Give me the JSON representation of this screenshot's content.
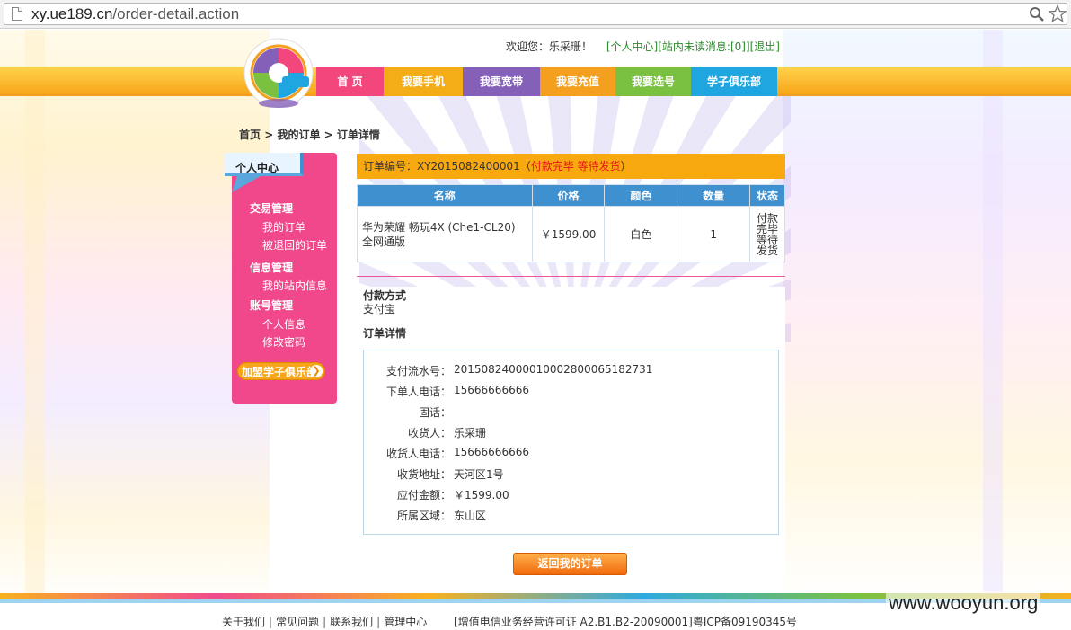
{
  "browser": {
    "url_host": "xy.ue189.cn",
    "url_path": "/order-detail.action"
  },
  "header": {
    "welcome": "欢迎您：乐采珊！",
    "link_profile": "[个人中心]",
    "link_messages": "[站内未读消息:[0]]",
    "link_logout": "[退出]"
  },
  "nav": [
    "首 页",
    "我要手机",
    "我要宽带",
    "我要充值",
    "我要选号",
    "学子俱乐部"
  ],
  "breadcrumb": {
    "home": "首页",
    "sep1": " > ",
    "orders": "我的订单",
    "sep2": " > ",
    "current": "订单详情"
  },
  "sidebar": {
    "title": "个人中心",
    "sections": [
      {
        "label": "交易管理",
        "items": [
          "我的订单",
          "被退回的订单"
        ]
      },
      {
        "label": "信息管理",
        "items": [
          "我的站内信息"
        ]
      },
      {
        "label": "账号管理",
        "items": [
          "个人信息",
          "修改密码"
        ]
      }
    ],
    "join_button": "加盟学子俱乐部"
  },
  "order": {
    "number_label": "订单编号：XY2015082400001（",
    "status": "付款完毕 等待发货",
    "close_paren": "）",
    "table_headers": [
      "名称",
      "价格",
      "颜色",
      "数量",
      "状态"
    ],
    "items": [
      {
        "name": "华为荣耀 畅玩4X (Che1-CL20) 全网通版",
        "price": "￥1599.00",
        "color": "白色",
        "qty": "1",
        "status": "付款完毕等待发货"
      }
    ],
    "payment_label": "付款方式",
    "payment_value": "支付宝",
    "detail_label": "订单详情",
    "details": [
      {
        "k": "支付流水号：",
        "v": "20150824000010002800065182731"
      },
      {
        "k": "下单人电话：",
        "v": "15666666666"
      },
      {
        "k": "固话：",
        "v": ""
      },
      {
        "k": "收货人：",
        "v": "乐采珊"
      },
      {
        "k": "收货人电话：",
        "v": "15666666666"
      },
      {
        "k": "收货地址：",
        "v": "天河区1号"
      },
      {
        "k": "应付金额：",
        "v": "￥1599.00"
      },
      {
        "k": "所属区域：",
        "v": "东山区"
      }
    ],
    "back_button": "返回我的订单"
  },
  "footer": {
    "links": [
      "关于我们",
      "常见问题",
      "联系我们",
      "管理中心"
    ],
    "license": "[增值电信业务经营许可证 A2.B1.B2-20090001]粤ICP备09190345号"
  },
  "watermark": "www.wooyun.org"
}
